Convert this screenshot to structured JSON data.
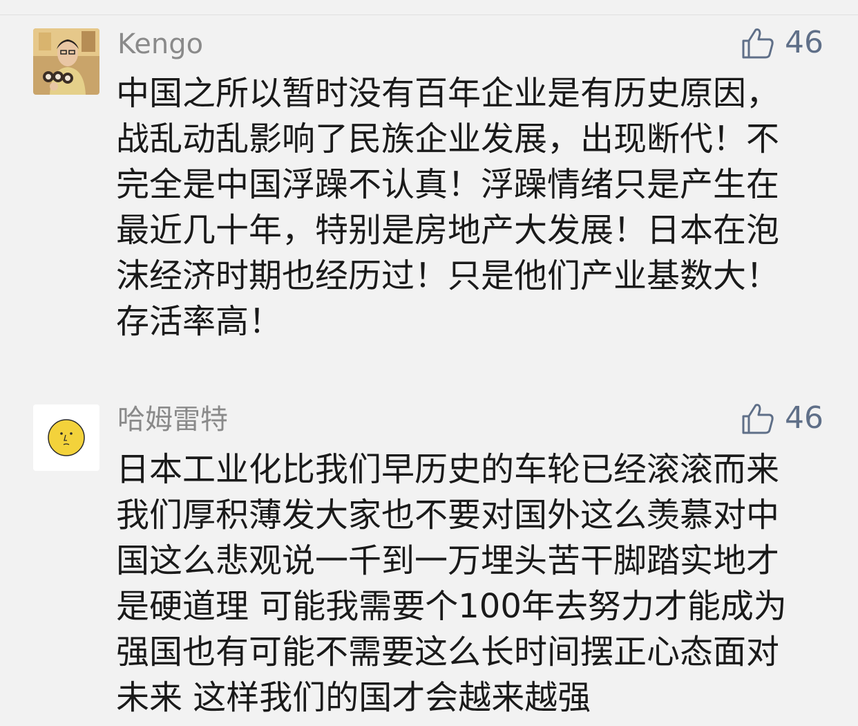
{
  "comments": [
    {
      "username": "Kengo",
      "avatar_icon": "person-photo-avatar",
      "like_icon": "thumbs-up-icon",
      "likes": "46",
      "lines": [
        "中国之所以暂时没有百年企业是有历史原因，",
        "战乱动乱影响了民族企业发展，出现断代！不",
        "完全是中国浮躁不认真！浮躁情绪只是产生在",
        "最近几十年，特别是房地产大发展！日本在泡",
        "沫经济时期也经历过！只是他们产业基数大！",
        "存活率高！"
      ]
    },
    {
      "username": "哈姆雷特",
      "avatar_icon": "smiley-face-avatar",
      "like_icon": "thumbs-up-icon",
      "likes": "46",
      "lines": [
        "日本工业化比我们早历史的车轮已经滚滚而来",
        "我们厚积薄发大家也不要对国外这么羡慕对中",
        "国这么悲观说一千到一万埋头苦干脚踏实地才",
        "是硬道理 可能我需要个100年去努力才能成为",
        "强国也有可能不需要这么长时间摆正心态面对",
        "未来 这样我们的国才会越来越强"
      ]
    }
  ],
  "colors": {
    "background": "#f2f2f2",
    "username": "#8a8a8a",
    "like_accent": "#5f6f88",
    "body_text": "#1a1a1a"
  }
}
